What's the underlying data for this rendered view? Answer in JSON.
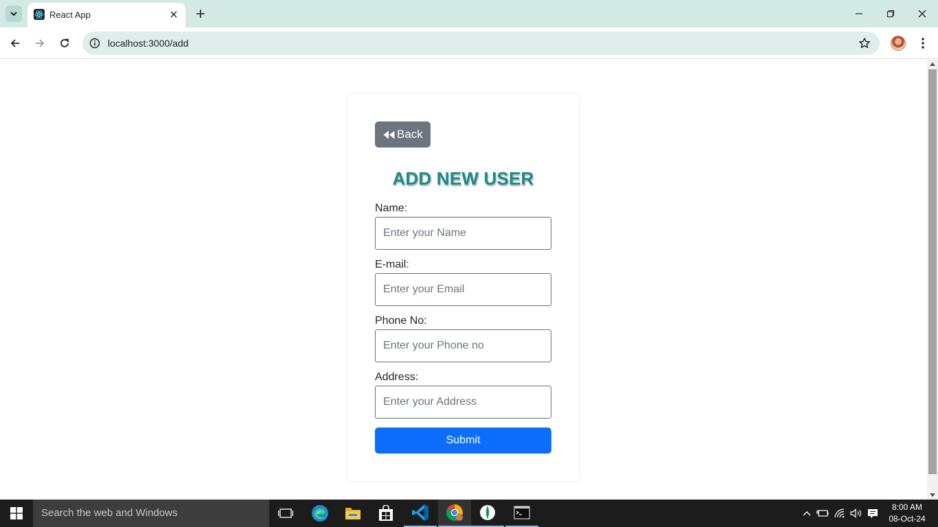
{
  "browser": {
    "tab_title": "React App",
    "url": "localhost:3000/add",
    "accent": "#d3e9e4"
  },
  "page": {
    "back_label": "Back",
    "title": "ADD NEW USER",
    "fields": [
      {
        "label": "Name:",
        "placeholder": "Enter your Name"
      },
      {
        "label": "E-mail:",
        "placeholder": "Enter your Email"
      },
      {
        "label": "Phone No:",
        "placeholder": "Enter your Phone no"
      },
      {
        "label": "Address:",
        "placeholder": "Enter your Address"
      }
    ],
    "submit_label": "Submit",
    "colors": {
      "title": "#1a8a8a",
      "submit": "#0d6efd",
      "back": "#6c757d"
    }
  },
  "taskbar": {
    "search_placeholder": "Search the web and Windows",
    "time": "8:00 AM",
    "date": "08-Oct-24",
    "apps": [
      "task-view-icon",
      "edge-icon",
      "file-explorer-icon",
      "store-icon",
      "vscode-icon",
      "chrome-icon",
      "mongodb-compass-icon",
      "terminal-icon"
    ]
  }
}
